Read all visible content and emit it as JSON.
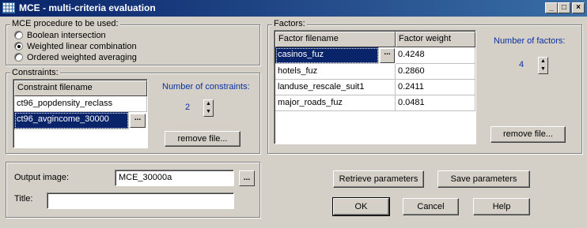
{
  "window": {
    "title": "MCE - multi-criteria evaluation",
    "minimize": "_",
    "maximize": "□",
    "close": "×"
  },
  "procedure": {
    "label": "MCE procedure to be used:",
    "options": [
      "Boolean intersection",
      "Weighted linear combination",
      "Ordered weighted averaging"
    ],
    "selected_index": 1
  },
  "constraints": {
    "label": "Constraints:",
    "column_header": "Constraint filename",
    "rows": [
      "ct96_popdensity_reclass",
      "ct96_avgincome_30000"
    ],
    "selected_index": 1,
    "count_label": "Number of constraints:",
    "count": "2",
    "remove_button": "remove file...",
    "ellipsis": "..."
  },
  "factors": {
    "label": "Factors:",
    "headers": [
      "Factor filename",
      "Factor weight"
    ],
    "rows": [
      {
        "filename": "casinos_fuz",
        "weight": "0.4248"
      },
      {
        "filename": "hotels_fuz",
        "weight": "0.2860"
      },
      {
        "filename": "landuse_rescale_suit1",
        "weight": "0.2411"
      },
      {
        "filename": "major_roads_fuz",
        "weight": "0.0481"
      }
    ],
    "selected_index": 0,
    "count_label": "Number of factors:",
    "count": "4",
    "remove_button": "remove file...",
    "ellipsis": "..."
  },
  "output": {
    "image_label": "Output image:",
    "image_value": "MCE_30000a",
    "title_label": "Title:",
    "title_value": "",
    "ellipsis": "..."
  },
  "buttons": {
    "retrieve": "Retrieve parameters",
    "save": "Save parameters",
    "ok": "OK",
    "cancel": "Cancel",
    "help": "Help"
  },
  "colors": {
    "titlebar": "#0a246a",
    "selection": "#0a246a",
    "count_text": "#0b2fa0",
    "face": "#d4d0c8"
  }
}
